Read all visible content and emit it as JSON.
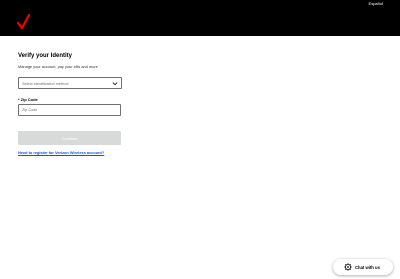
{
  "header": {
    "language_link": "Español",
    "logo_icon": "verizon-check-logo",
    "brand_color": "#ee0000"
  },
  "form": {
    "title": "Verify your Identity",
    "subtitle": "Manage your account, pay your bills and more.",
    "id_method_select": {
      "value": "Select identification method",
      "icon": "chevron-down-icon"
    },
    "zip_label": "* Zip Code",
    "zip_placeholder": "Zip Code",
    "continue_label": "Continue",
    "register_link": "Need to register for Verizon Wireless account?"
  },
  "chat": {
    "label": "Chat with us",
    "icon": "chat-settings-icon"
  }
}
